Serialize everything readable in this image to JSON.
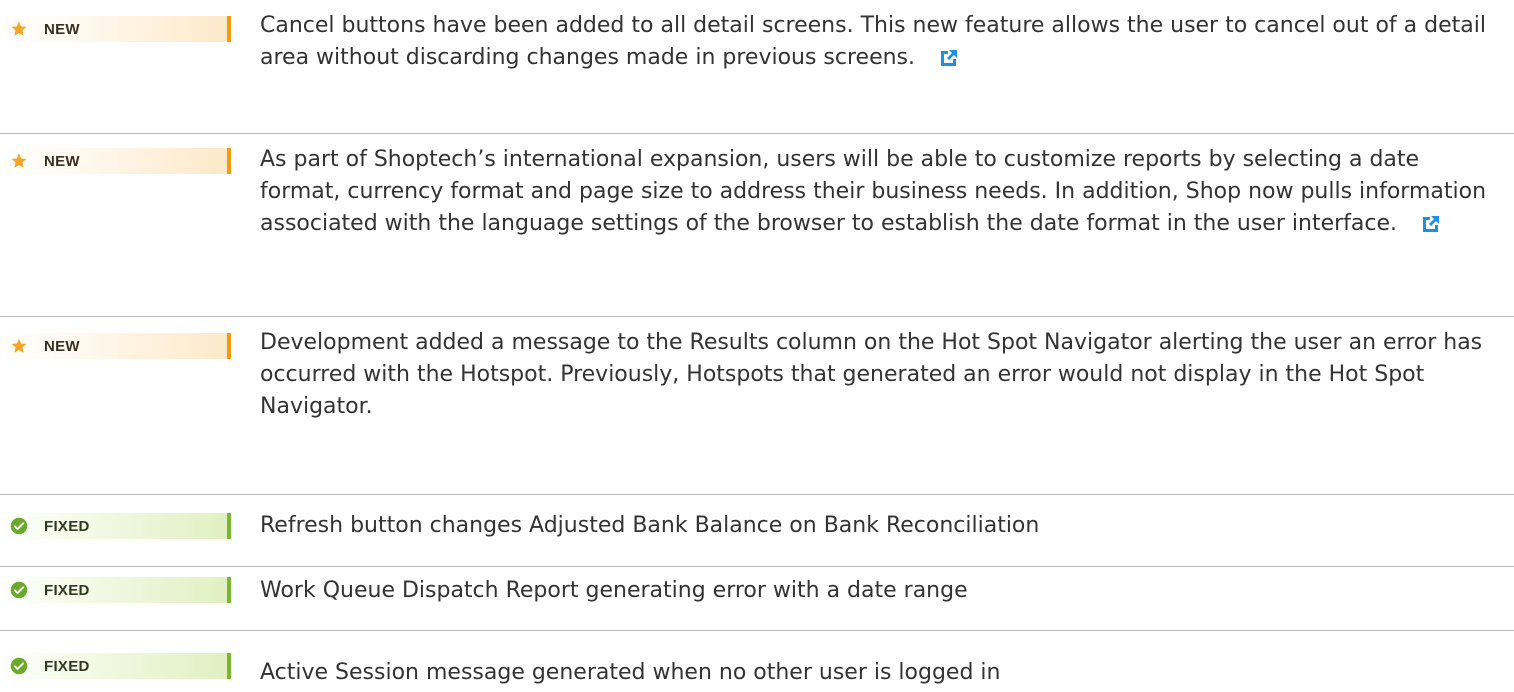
{
  "rows": [
    {
      "badge": "NEW",
      "kind": "new",
      "text": "Cancel buttons have been added to all detail screens.  This new feature allows the user to cancel out of a detail area without discarding changes made in previous screens.",
      "has_link": true
    },
    {
      "badge": "NEW",
      "kind": "new",
      "text": "As part of Shoptech’s international expansion, users will be able to customize reports by selecting a date format, currency format and page size to address their business needs.  In addition, Shop now pulls information associated with the language settings of the browser to establish the date format in the user interface.",
      "has_link": true
    },
    {
      "badge": "NEW",
      "kind": "new",
      "text": "Development added a message to the Results column on the Hot Spot Navigator alerting the user an error has occurred with the Hotspot. Previously, Hotspots that generated an error would not display in the Hot Spot Navigator.",
      "has_link": false
    },
    {
      "badge": "FIXED",
      "kind": "fixed",
      "text": "Refresh button changes Adjusted Bank Balance on Bank Reconciliation",
      "has_link": false
    },
    {
      "badge": "FIXED",
      "kind": "fixed",
      "text": "Work Queue Dispatch Report generating error with a date range",
      "has_link": false
    },
    {
      "badge": "FIXED",
      "kind": "fixed",
      "text": "Active Session message generated when no other user is logged in",
      "has_link": false
    }
  ],
  "colors": {
    "new_accent": "#f39c12",
    "fixed_accent": "#7cb82f",
    "star": "#f5a623",
    "check": "#6aaa2a",
    "link_icon": "#1e90e0"
  },
  "icons": {
    "new": "star-icon",
    "fixed": "check-circle-icon",
    "link": "external-link-icon"
  }
}
